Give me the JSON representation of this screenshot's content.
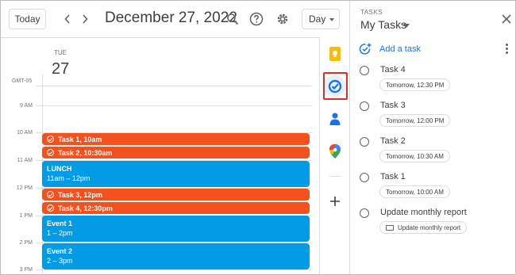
{
  "toolbar": {
    "today_label": "Today",
    "date_title": "December 27, 2022",
    "view_label": "Day"
  },
  "day": {
    "weekday": "TUE",
    "date": "27",
    "timezone": "GMT-05"
  },
  "time_labels": [
    "9 AM",
    "10 AM",
    "11 AM",
    "12 PM",
    "1 PM",
    "2 PM",
    "3 PM"
  ],
  "events": [
    {
      "title": "Task 1, 10am",
      "kind": "task"
    },
    {
      "title": "Task 2, 10:30am",
      "kind": "task"
    },
    {
      "title": "LUNCH",
      "time": "11am – 12pm",
      "kind": "event"
    },
    {
      "title": "Task 3, 12pm",
      "kind": "task"
    },
    {
      "title": "Task 4, 12:30pm",
      "kind": "task"
    },
    {
      "title": "Event 1",
      "time": "1 – 2pm",
      "kind": "event"
    },
    {
      "title": "Event 2",
      "time": "2 – 3pm",
      "kind": "event"
    }
  ],
  "colors": {
    "task_event": "#f4511e",
    "calendar_event": "#039be5",
    "accent": "#1a73e8",
    "highlight": "#d93025"
  },
  "panel": {
    "label": "TASKS",
    "title": "My Tasks",
    "add_task_label": "Add a task",
    "tasks": [
      {
        "name": "Task 4",
        "chip": "Tomorrow, 12:30 PM"
      },
      {
        "name": "Task 3",
        "chip": "Tomorrow, 12:00 PM"
      },
      {
        "name": "Task 2",
        "chip": "Tomorrow, 10:30 AM"
      },
      {
        "name": "Task 1",
        "chip": "Tomorrow, 10:00 AM"
      },
      {
        "name": "Update monthly report",
        "chip": "Update monthly report"
      }
    ]
  }
}
